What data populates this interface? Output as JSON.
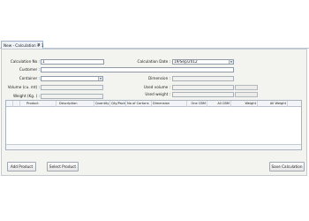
{
  "tab": {
    "title": "New - Calculation # 1",
    "close_glyph": "✕"
  },
  "form": {
    "calculation_no": {
      "label": "Calculation No :",
      "value": "1"
    },
    "calculation_date": {
      "label": "Calculation Date :",
      "value": "19/Sep/2012",
      "arrow": "▾"
    },
    "customer": {
      "label": "Customer :",
      "value": ""
    },
    "container": {
      "label": "Container :",
      "value": "",
      "arrow": "▾"
    },
    "dimension": {
      "label": "Dimension :",
      "value": ""
    },
    "volume": {
      "label": "Volume (cu. mt) :",
      "value": ""
    },
    "used_volume": {
      "label": "Used volume :",
      "value": ""
    },
    "weight": {
      "label": "Weight (Kg. ) :",
      "value": ""
    },
    "used_weight": {
      "label": "Used weight :",
      "value": ""
    }
  },
  "grid": {
    "columns": [
      "Product",
      "Description",
      "Quantity",
      "Qty/Pack",
      "No of Cartons",
      "Dimension",
      "One CBM",
      "All CBM",
      "Weight",
      "All Weight"
    ]
  },
  "buttons": {
    "add_product": "Add Product",
    "select_product": "Select Product",
    "save_calculation": "Save Calculation"
  }
}
